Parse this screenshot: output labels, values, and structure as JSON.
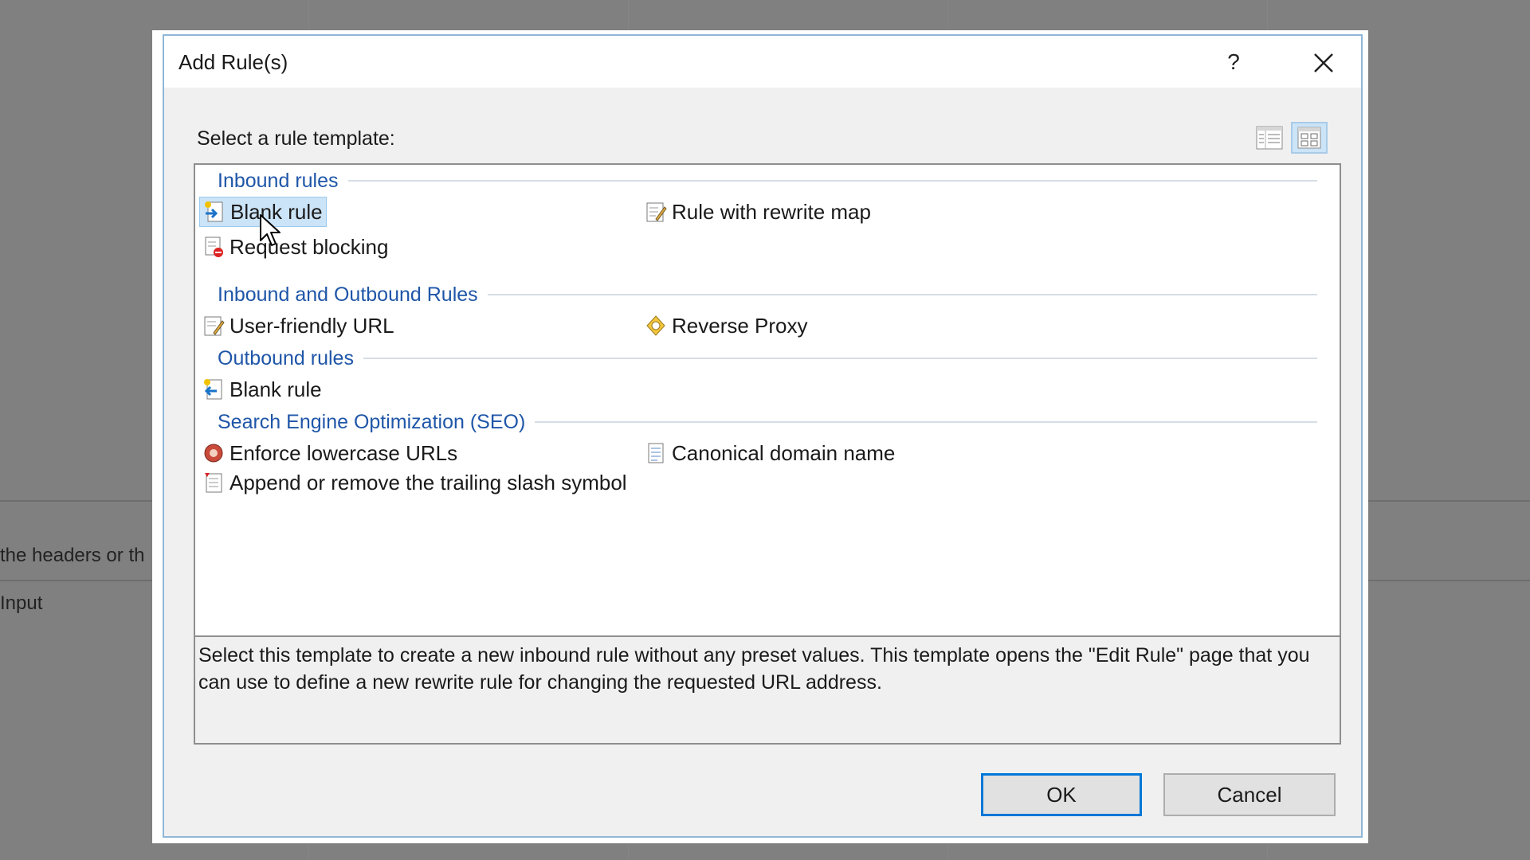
{
  "background": {
    "text_line1": "the headers or th",
    "text_line2": "Input"
  },
  "dialog": {
    "title": "Add Rule(s)",
    "help_label": "?",
    "close_label": "✕",
    "prompt": "Select a rule template:",
    "view_buttons": [
      "details-view-icon",
      "large-icons-view-icon"
    ],
    "groups": [
      {
        "title": "Inbound rules",
        "items": [
          {
            "label": "Blank rule",
            "icon": "inbound-rule-icon",
            "selected": true
          },
          {
            "label": "Rule with rewrite map",
            "icon": "rewrite-map-icon"
          },
          {
            "label": "Request blocking",
            "icon": "request-blocking-icon"
          }
        ]
      },
      {
        "title": "Inbound and Outbound Rules",
        "items": [
          {
            "label": "User-friendly URL",
            "icon": "user-friendly-url-icon"
          },
          {
            "label": "Reverse Proxy",
            "icon": "reverse-proxy-icon"
          }
        ]
      },
      {
        "title": "Outbound rules",
        "items": [
          {
            "label": "Blank rule",
            "icon": "outbound-rule-icon"
          }
        ]
      },
      {
        "title": "Search Engine Optimization (SEO)",
        "items": [
          {
            "label": "Enforce lowercase URLs",
            "icon": "lowercase-url-icon"
          },
          {
            "label": "Canonical domain name",
            "icon": "canonical-domain-icon"
          },
          {
            "label": "Append or remove the trailing slash symbol",
            "icon": "trailing-slash-icon"
          }
        ]
      }
    ],
    "description": "Select this template to create a new inbound rule without any preset values. This template opens the \"Edit Rule\" page that you can use to define a new rewrite rule for changing the requested URL address.",
    "ok_label": "OK",
    "cancel_label": "Cancel"
  },
  "colors": {
    "group_title": "#1f56a8",
    "selection": "#cce4f7",
    "default_button_border": "#0078d7"
  }
}
